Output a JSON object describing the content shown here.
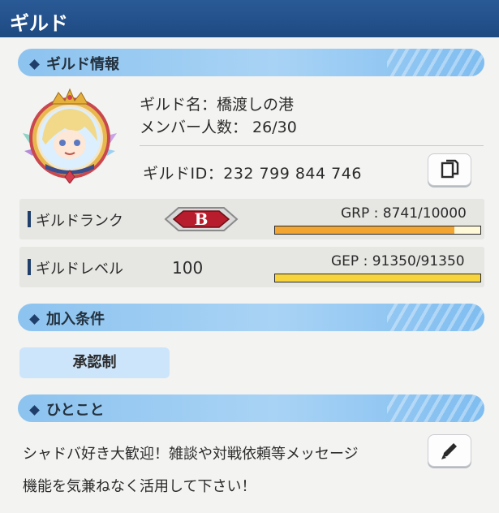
{
  "window": {
    "title": "ギルド"
  },
  "guild_info": {
    "header": "ギルド情報",
    "name_line": "ギルド名：橋渡しの港",
    "members_line": "メンバー人数： 26/30",
    "id_line": "ギルドID：232 799 844 746"
  },
  "rank": {
    "label": "ギルドランク",
    "badge": "B",
    "points_text": "GRP : 8741/10000",
    "progress": 0.874,
    "bar_color": "#f2a531"
  },
  "level": {
    "label": "ギルドレベル",
    "value": "100",
    "points_text": "GEP : 91350/91350",
    "progress": 1.0,
    "bar_color": "#f7d43c"
  },
  "conditions": {
    "header": "加入条件",
    "value": "承認制"
  },
  "comment": {
    "header": "ひとこと",
    "line1": "シャドバ好き大歓迎！雑談や対戦依頼等メッセージ",
    "line2": "機能を気兼ねなく活用して下さい！"
  },
  "icons": {
    "copy": "copy-icon",
    "edit": "pencil-icon",
    "avatar": "guild-emblem-avatar"
  }
}
